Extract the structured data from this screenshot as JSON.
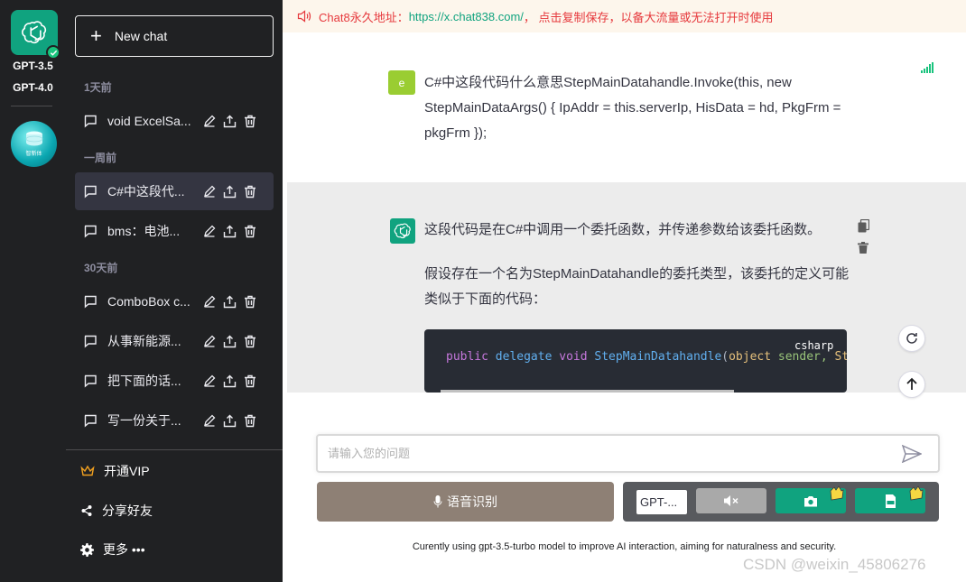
{
  "rail": {
    "models": [
      "GPT-3.5",
      "GPT-4.0"
    ],
    "avatar_label": "智新体"
  },
  "sidebar": {
    "new_chat_label": "New chat",
    "groups": [
      {
        "label": "1天前"
      },
      {
        "label": "一周前"
      },
      {
        "label": "30天前"
      }
    ],
    "conversations": [
      {
        "title": "void ExcelSa..."
      },
      {
        "title": "C#中这段代..."
      },
      {
        "title": "bms：电池..."
      },
      {
        "title": "ComboBox c..."
      },
      {
        "title": "从事新能源..."
      },
      {
        "title": "把下面的话..."
      },
      {
        "title": "写一份关于..."
      }
    ],
    "bottom": {
      "vip_label": "开通VIP",
      "share_label": "分享好友",
      "more_label": "更多 •••"
    }
  },
  "notice": {
    "prefix": "Chat8永久地址：",
    "url": "https://x.chat838.com/",
    "suffix": "， 点击复制保存，以备大流量或无法打开时使用"
  },
  "user_message": {
    "avatar_letter": "e",
    "text": "C#中这段代码什么意思StepMainDatahandle.Invoke(this, new StepMainDataArgs() { IpAddr = this.serverIp, HisData = hd, PkgFrm = pkgFrm });"
  },
  "bot_message": {
    "paragraph1": "这段代码是在C#中调用一个委托函数，并传递参数给该委托函数。",
    "paragraph2": "假设存在一个名为StepMainDatahandle的委托类型，该委托的定义可能类似于下面的代码：",
    "code_lang": "csharp",
    "code_tokens": {
      "public": "public",
      "delegate": "delegate",
      "void": "void",
      "name": "StepMainDatahandle",
      "paren": "(",
      "type": "object",
      "param1": " sender,",
      "param2": " Ste"
    }
  },
  "input": {
    "placeholder": "请输入您的问题"
  },
  "controls": {
    "voice_label": "语音识别",
    "model_value": "GPT-..."
  },
  "footer": {
    "note": "Curently using gpt-3.5-turbo model to improve AI interaction, aiming for naturalness and security.",
    "watermark": "CSDN @weixin_45806276"
  },
  "colors": {
    "brand_green": "#10a37f",
    "sidebar_bg": "#202123",
    "notice_red": "#e6393d",
    "voice_btn": "#8e8075"
  }
}
